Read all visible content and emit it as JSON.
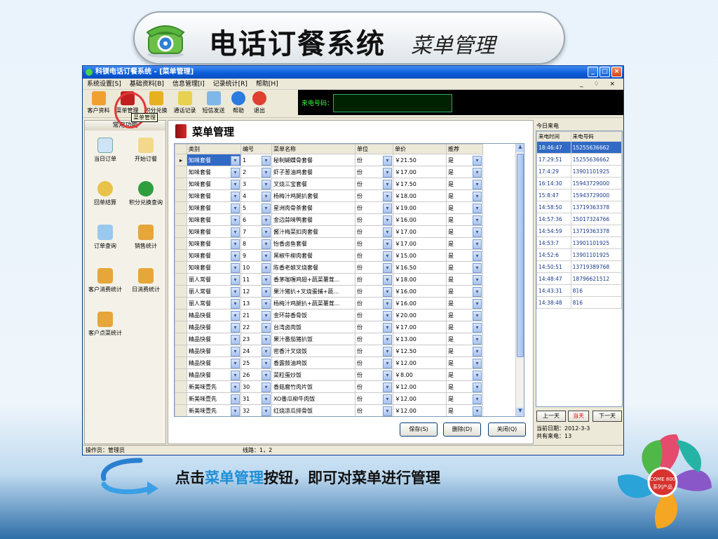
{
  "slide": {
    "title": "电话订餐系统",
    "subtitle": "菜单管理",
    "caption_prefix": "点击",
    "caption_highlight": "菜单管理",
    "caption_suffix": "按钮，即可对菜单进行管理",
    "logo_text": "COME 800",
    "logo_sub": "系列产品"
  },
  "window": {
    "title": "科镁电话订餐系统 - [菜单管理]",
    "controls": [
      "_",
      "□",
      "×"
    ],
    "menu": [
      "系统设置[S]",
      "基础资料[B]",
      "信息管理[I]",
      "记录统计[R]",
      "帮助[H]"
    ],
    "mdi_controls": "_ ♢ ×",
    "toolbar": [
      {
        "label": "客户资料",
        "icon": "people-icon",
        "color": "#f0a030"
      },
      {
        "label": "菜单管理",
        "icon": "menu-book-icon",
        "color": "#c02020"
      },
      {
        "label": "积分兑换",
        "icon": "coins-icon",
        "color": "#e6b020"
      },
      {
        "label": "通话记录",
        "icon": "call-log-icon",
        "color": "#e8d050"
      },
      {
        "label": "短信发送",
        "icon": "sms-icon",
        "color": "#7fb8e8"
      },
      {
        "label": "帮助",
        "icon": "help-icon",
        "color": "#2a7ae0"
      },
      {
        "label": "退出",
        "icon": "exit-icon",
        "color": "#e04030"
      }
    ],
    "tooltip": "菜单管理",
    "caller_label": "来电号码：",
    "caller_value": ""
  },
  "left_panel": {
    "header": "常用功能",
    "items": [
      {
        "label": "当日订单",
        "icon": "document-icon",
        "color": "#cfe3f6"
      },
      {
        "label": "开始订餐",
        "icon": "pencil-icon",
        "color": "#f3d88a"
      },
      {
        "label": "回单结算",
        "icon": "coins-icon",
        "color": "#e9c24a"
      },
      {
        "label": "积分兑换查询",
        "icon": "dollar-icon",
        "color": "#2e9e3e"
      },
      {
        "label": "订单查询",
        "icon": "search-doc-icon",
        "color": "#9ac8ee"
      },
      {
        "label": "销售统计",
        "icon": "cube-icon",
        "color": "#e6a63a"
      },
      {
        "label": "客户消费统计",
        "icon": "cube-icon",
        "color": "#e6a63a"
      },
      {
        "label": "日消费统计",
        "icon": "cube-icon",
        "color": "#e6a63a"
      },
      {
        "label": "客户点菜统计",
        "icon": "cube-icon",
        "color": "#e6a63a"
      }
    ]
  },
  "menu_panel": {
    "title": "菜单管理",
    "columns": [
      "类别",
      "编号",
      "菜单名称",
      "单位",
      "单价",
      "推荐"
    ],
    "rows": [
      [
        "知味套餐",
        "1",
        "秘制蝴蝶骨套餐",
        "份",
        "￥21.50",
        "是"
      ],
      [
        "知味套餐",
        "2",
        "虾子葱油鸡套餐",
        "份",
        "￥17.00",
        "是"
      ],
      [
        "知味套餐",
        "3",
        "叉烧三宝套餐",
        "份",
        "￥17.50",
        "是"
      ],
      [
        "知味套餐",
        "4",
        "杨梅汁鸡腿扒套餐",
        "份",
        "￥18.00",
        "是"
      ],
      [
        "知味套餐",
        "5",
        "星洲肉骨茶套餐",
        "份",
        "￥19.00",
        "是"
      ],
      [
        "知味套餐",
        "6",
        "金边蒜味鸭套餐",
        "份",
        "￥16.00",
        "是"
      ],
      [
        "知味套餐",
        "7",
        "酱汁梅菜扣肉套餐",
        "份",
        "￥17.00",
        "是"
      ],
      [
        "知味套餐",
        "8",
        "怡香卤鱼套餐",
        "份",
        "￥17.00",
        "是"
      ],
      [
        "知味套餐",
        "9",
        "黑椒牛柳肉套餐",
        "份",
        "￥15.00",
        "是"
      ],
      [
        "知味套餐",
        "10",
        "陈香老娘叉烧套餐",
        "份",
        "￥16.50",
        "是"
      ],
      [
        "丽人常餐",
        "11",
        "香茅咖喱鸡翅+蔬菜薯茸...",
        "份",
        "￥18.00",
        "是"
      ],
      [
        "丽人常餐",
        "12",
        "果汁猪扒+叉烧蛋捕+蔬...",
        "份",
        "￥16.00",
        "是"
      ],
      [
        "丽人常餐",
        "13",
        "杨梅汁鸡腿扒+蔬菜薯茸...",
        "份",
        "￥16.00",
        "是"
      ],
      [
        "精品快餐",
        "21",
        "金环蒜香骨饭",
        "份",
        "￥20.00",
        "是"
      ],
      [
        "精品快餐",
        "22",
        "台湾卤肉饭",
        "份",
        "￥17.00",
        "是"
      ],
      [
        "精品快餐",
        "23",
        "果汁番茄猪扒饭",
        "份",
        "￥13.00",
        "是"
      ],
      [
        "精品快餐",
        "24",
        "密香汁叉烧饭",
        "份",
        "￥12.50",
        "是"
      ],
      [
        "精品快餐",
        "25",
        "香露鼓油鸡饭",
        "份",
        "￥12.00",
        "是"
      ],
      [
        "精品快餐",
        "26",
        "菜粒蛋炒饭",
        "份",
        "￥8.00",
        "是"
      ],
      [
        "新美味壹先",
        "30",
        "香菇腐竹肉片饭",
        "份",
        "￥12.00",
        "是"
      ],
      [
        "新美味壹先",
        "31",
        "XO番瓜柳牛肉饭",
        "份",
        "￥12.00",
        "是"
      ],
      [
        "新美味壹先",
        "32",
        "红烧凉瓜排骨饭",
        "份",
        "￥12.00",
        "是"
      ]
    ],
    "buttons": {
      "save": "保存(S)",
      "delete": "删除(D)",
      "close": "关闭(Q)"
    }
  },
  "calls_panel": {
    "label": "今日来电",
    "columns": [
      "来电时间",
      "来电号码"
    ],
    "rows": [
      [
        "18:46:47",
        "15255636662"
      ],
      [
        "17:29:51",
        "15255636662"
      ],
      [
        "17:4:29",
        "13901101925"
      ],
      [
        "16:14:30",
        "15943729000"
      ],
      [
        "15:8:47",
        "15943729000"
      ],
      [
        "14:58:50",
        "13719363378"
      ],
      [
        "14:57:36",
        "15017324766"
      ],
      [
        "14:54:59",
        "13719363378"
      ],
      [
        "14:53:7",
        "13901101925"
      ],
      [
        "14:52:6",
        "13901101925"
      ],
      [
        "14:50:51",
        "13719389768"
      ],
      [
        "14:48:47",
        "18796621512"
      ],
      [
        "14:43:31",
        "816"
      ],
      [
        "14:38:48",
        "816"
      ]
    ],
    "prev_day": "上一天",
    "today": "当天",
    "next_day": "下一天",
    "current_date": "当前日期：2012-3-3",
    "total_calls": "共有来电：13"
  },
  "status_bar": {
    "operator": "操作员：管理员",
    "line": "线路：1，2"
  },
  "colors": {
    "accent": "#316ac5",
    "highlight_ring": "#e23a3a",
    "caption_highlight": "#1f8fd6"
  }
}
